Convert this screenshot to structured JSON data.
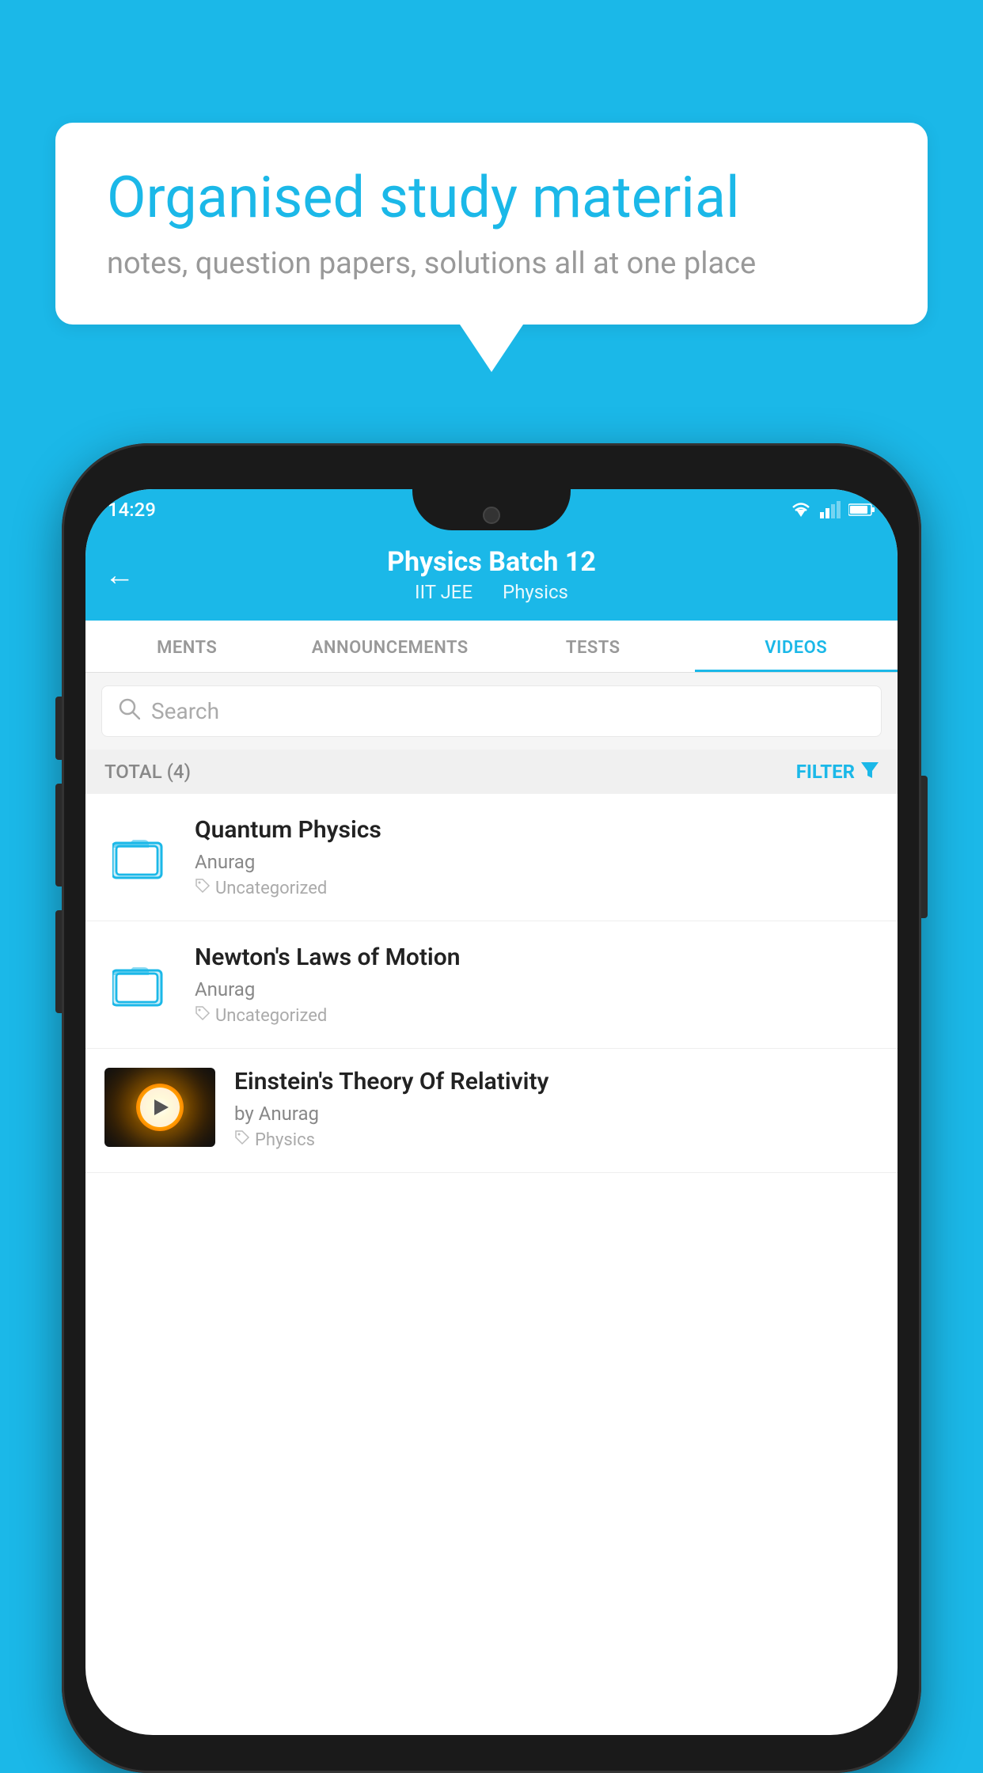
{
  "page": {
    "bg_color": "#1BB8E8"
  },
  "bubble": {
    "heading": "Organised study material",
    "subtext": "notes, question papers, solutions all at one place"
  },
  "status_bar": {
    "time": "14:29",
    "wifi": "▲",
    "signal": "▲",
    "battery": "▮"
  },
  "header": {
    "title": "Physics Batch 12",
    "subtitle_left": "IIT JEE",
    "subtitle_right": "Physics"
  },
  "tabs": [
    {
      "label": "MENTS",
      "active": false
    },
    {
      "label": "ANNOUNCEMENTS",
      "active": false
    },
    {
      "label": "TESTS",
      "active": false
    },
    {
      "label": "VIDEOS",
      "active": true
    }
  ],
  "search": {
    "placeholder": "Search"
  },
  "filter_bar": {
    "total_label": "TOTAL (4)",
    "filter_label": "FILTER"
  },
  "videos": [
    {
      "title": "Quantum Physics",
      "author": "Anurag",
      "tag": "Uncategorized",
      "has_thumb": false,
      "thumb_type": "folder"
    },
    {
      "title": "Newton's Laws of Motion",
      "author": "Anurag",
      "tag": "Uncategorized",
      "has_thumb": false,
      "thumb_type": "folder"
    },
    {
      "title": "Einstein's Theory Of Relativity",
      "author_prefix": "by ",
      "author": "Anurag",
      "tag": "Physics",
      "has_thumb": true,
      "thumb_type": "cosmos"
    }
  ]
}
